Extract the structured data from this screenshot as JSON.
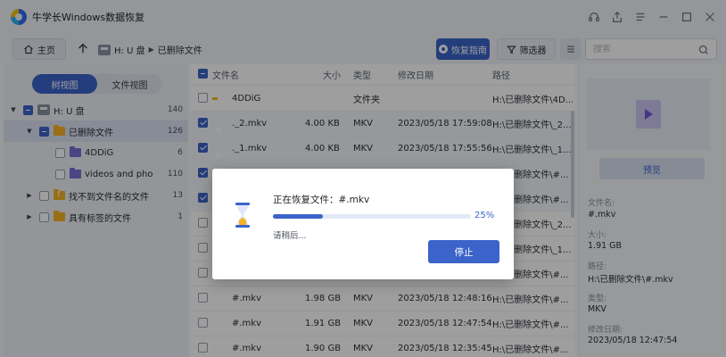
{
  "window": {
    "title": "牛学长Windows数据恢复"
  },
  "toolbar": {
    "home_label": "主页",
    "breadcrumb": [
      "H: U 盘",
      "已删除文件"
    ],
    "guide_label": "恢复指南",
    "filter_label": "筛选器",
    "search_placeholder": "搜索"
  },
  "sidebar": {
    "view_tabs": [
      "树视图",
      "文件视图"
    ],
    "active_view": "树视图",
    "tree": [
      {
        "label": "H: U 盘",
        "count": "140",
        "expanded": true
      },
      {
        "label": "已删除文件",
        "count": "126",
        "expanded": true,
        "selected": true
      },
      {
        "label": "4DDiG",
        "count": "6"
      },
      {
        "label": "videos and photos...",
        "count": "110"
      },
      {
        "label": "找不到文件名的文件",
        "count": "13"
      },
      {
        "label": "具有标签的文件",
        "count": "1"
      }
    ]
  },
  "table": {
    "headers": {
      "name": "文件名",
      "size": "大小",
      "type": "类型",
      "date": "修改日期",
      "path": "路径"
    },
    "rows": [
      {
        "name": "4DDiG",
        "size": "",
        "type": "文件夹",
        "date": "",
        "path": "H:\\已删除文件\\4D...",
        "checked": false,
        "kind": "folder"
      },
      {
        "name": "._2.mkv",
        "size": "4.00 KB",
        "type": "MKV",
        "date": "2023/05/18 17:59:08",
        "path": "H:\\已删除文件\\_2...",
        "checked": true,
        "kind": "video"
      },
      {
        "name": "._1.mkv",
        "size": "4.00 KB",
        "type": "MKV",
        "date": "2023/05/18 17:55:56",
        "path": "H:\\已删除文件\\_1...",
        "checked": true,
        "kind": "video"
      },
      {
        "name": "",
        "size": "",
        "type": "",
        "date": "",
        "path": "H:\\已删除文件\\#...",
        "checked": true,
        "kind": "video"
      },
      {
        "name": "",
        "size": "",
        "type": "",
        "date": "",
        "path": "H:\\已删除文件\\#...",
        "checked": true,
        "kind": "video"
      },
      {
        "name": "",
        "size": "",
        "type": "",
        "date": "",
        "path": "H:\\已删除文件\\_2...",
        "checked": false,
        "kind": "video"
      },
      {
        "name": "",
        "size": "",
        "type": "",
        "date": "",
        "path": "H:\\已删除文件\\_1...",
        "checked": false,
        "kind": "video"
      },
      {
        "name": "",
        "size": "",
        "type": "",
        "date": "",
        "path": "H:\\已删除文件\\#...",
        "checked": false,
        "kind": "video"
      },
      {
        "name": "#.mkv",
        "size": "1.98 GB",
        "type": "MKV",
        "date": "2023/05/18 12:48:16",
        "path": "H:\\已删除文件\\#...",
        "checked": false,
        "kind": "video"
      },
      {
        "name": "#.mkv",
        "size": "1.91 GB",
        "type": "MKV",
        "date": "2023/05/18 12:47:54",
        "path": "H:\\已删除文件\\#...",
        "checked": false,
        "kind": "video"
      },
      {
        "name": "#.mkv",
        "size": "1.90 GB",
        "type": "MKV",
        "date": "2023/05/18 12:35:45",
        "path": "H:\\已删除文件\\#...",
        "checked": false,
        "kind": "video"
      }
    ]
  },
  "details": {
    "preview_label": "预览",
    "filename_label": "文件名:",
    "filename": "#.mkv",
    "size_label": "大小:",
    "size": "1.91 GB",
    "path_label": "路径:",
    "path": "H:\\已删除文件\\#.mkv",
    "type_label": "类型:",
    "type": "MKV",
    "date_label": "修改日期:",
    "date": "2023/05/18 12:47:54"
  },
  "dialog": {
    "title": "正在恢复文件：#.mkv",
    "progress": 0.25,
    "progress_text": "25%",
    "subtitle": "请稍后...",
    "stop_label": "停止"
  },
  "colors": {
    "accent": "#3b63c9",
    "folder": "#f5b324",
    "video": "#7b6fd6"
  }
}
